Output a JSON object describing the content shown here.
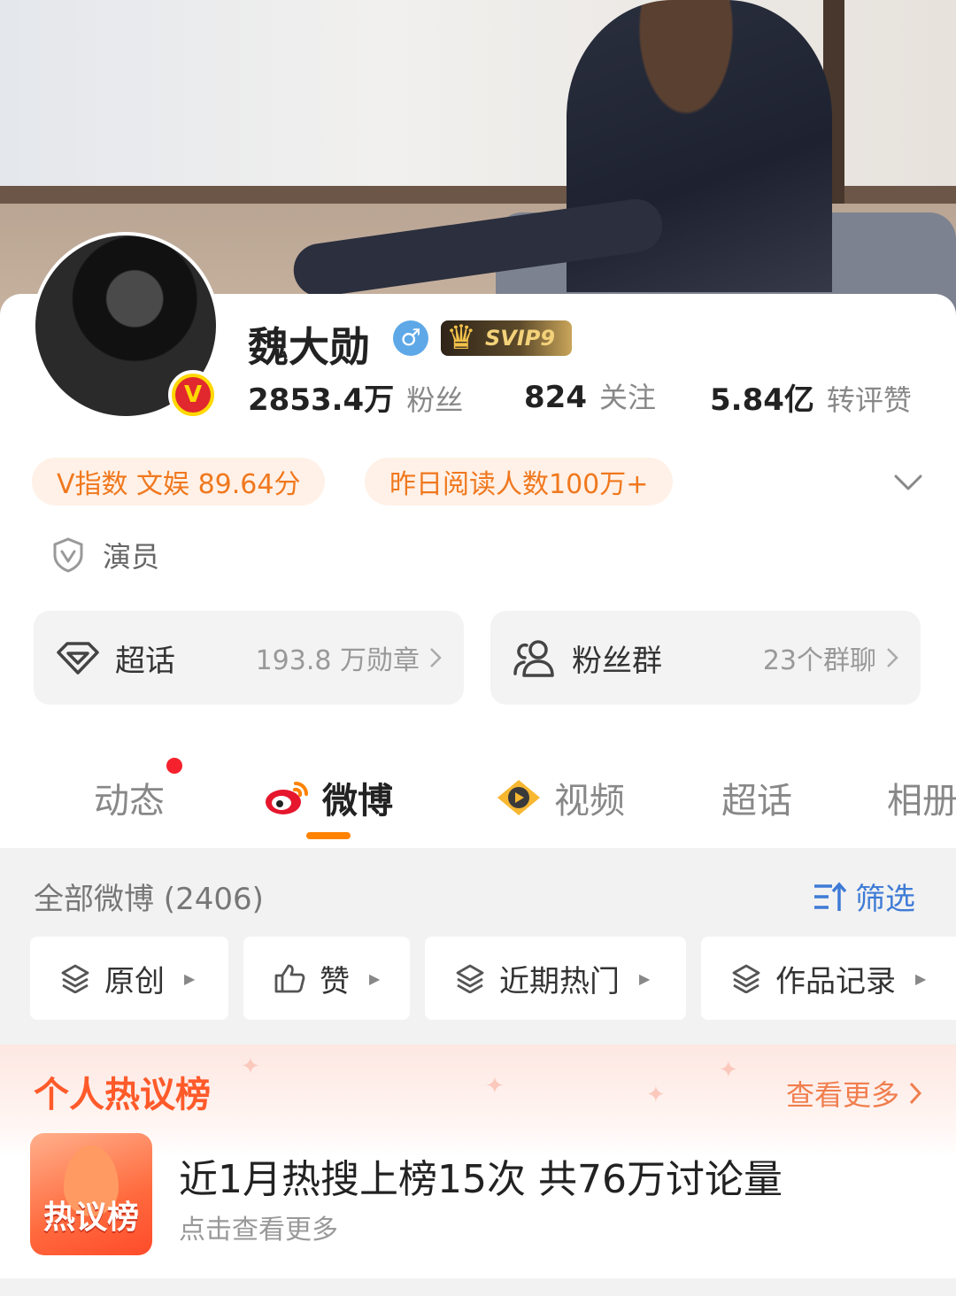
{
  "profile": {
    "name": "魏大勋",
    "gender_symbol": "♂",
    "vip_label": "SVIP9",
    "verified_mark": "V",
    "stats": [
      {
        "value": "2853.4万",
        "label": "粉丝"
      },
      {
        "value": "824",
        "label": "关注"
      },
      {
        "value": "5.84亿",
        "label": "转评赞"
      }
    ],
    "tags": [
      "V指数 文娱 89.64分",
      "昨日阅读人数100万+"
    ],
    "role": "演员"
  },
  "entries": {
    "supertopic": {
      "title": "超话",
      "meta": "193.8 万勋章"
    },
    "fangroup": {
      "title": "粉丝群",
      "meta": "23个群聊"
    }
  },
  "tabs": [
    "动态",
    "微博",
    "视频",
    "超话",
    "相册"
  ],
  "feed": {
    "all_label": "全部微博 (2406)",
    "filter_label": "筛选",
    "chips": [
      "原创",
      "赞",
      "近期热门",
      "作品记录"
    ]
  },
  "hot": {
    "title": "个人热议榜",
    "more": "查看更多",
    "icon_text": "热议榜",
    "headline": "近1月热搜上榜15次 共76万讨论量",
    "sub": "点击查看更多"
  },
  "colors": {
    "accent": "#ff8200",
    "link": "#3e7bd6",
    "hot": "#ff5a2a",
    "tag_text": "#f0781e"
  }
}
